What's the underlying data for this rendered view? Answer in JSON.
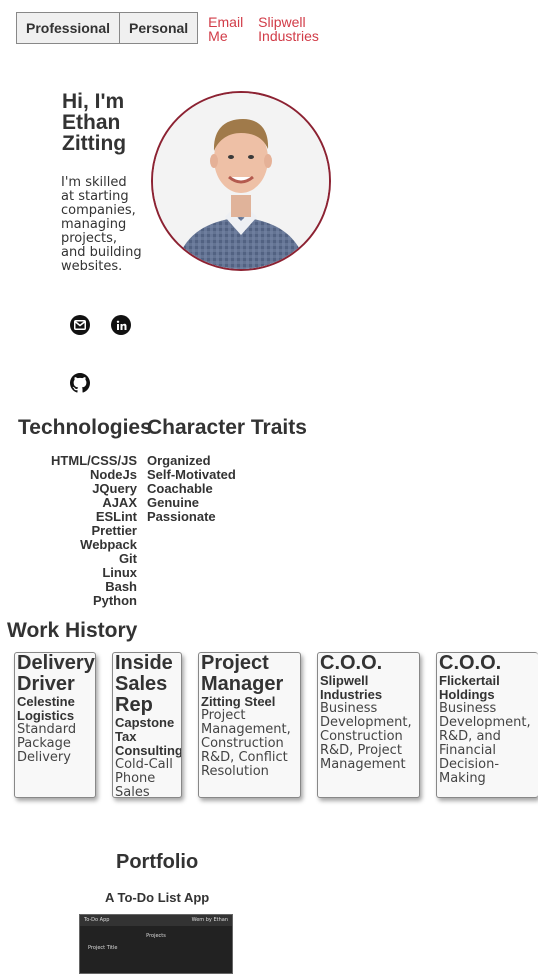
{
  "nav": {
    "toggle": [
      "Professional",
      "Personal"
    ],
    "links": [
      "Email Me",
      "Slipwell Industries"
    ]
  },
  "hero": {
    "title": "Hi, I'm Ethan Zitting",
    "text": "I'm skilled at starting companies, managing projects, and building websites."
  },
  "icons": [
    "mail-icon",
    "linkedin-icon",
    "github-icon"
  ],
  "technologies": {
    "title": "Technologies",
    "items": [
      "HTML/CSS/JS",
      "NodeJs",
      "JQuery",
      "AJAX",
      "ESLint",
      "Prettier",
      "Webpack",
      "Git",
      "Linux",
      "Bash",
      "Python"
    ]
  },
  "traits": {
    "title": "Character Traits",
    "items": [
      "Organized",
      "Self-Motivated",
      "Coachable",
      "Genuine",
      "Passionate"
    ]
  },
  "work": {
    "title": "Work History",
    "jobs": [
      {
        "role": "Delivery Driver",
        "company": "Celestine Logistics",
        "desc": "Standard Package Delivery"
      },
      {
        "role": "Inside Sales Rep",
        "company": "Capstone Tax Consulting",
        "desc": "Cold-Call Phone Sales"
      },
      {
        "role": "Project Manager",
        "company": "Zitting Steel",
        "desc": "Project Management, Construction R&D, Conflict Resolution"
      },
      {
        "role": "C.O.O.",
        "company": "Slipwell Industries",
        "desc": "Business Development, Construction R&D, Project Management"
      },
      {
        "role": "C.O.O.",
        "company": "Flickertail Holdings",
        "desc": "Business Development, R&D, and Financial Decision-Making"
      }
    ]
  },
  "portfolio": {
    "title": "Portfolio",
    "project_title": "A To-Do List App",
    "screenshot": {
      "app_name": "To-Do App",
      "byline": "Wem by Ethan",
      "heading": "Projects",
      "row": "Project Title"
    }
  },
  "colors": {
    "accent": "#d13b47",
    "photo_border": "#8c2232"
  }
}
